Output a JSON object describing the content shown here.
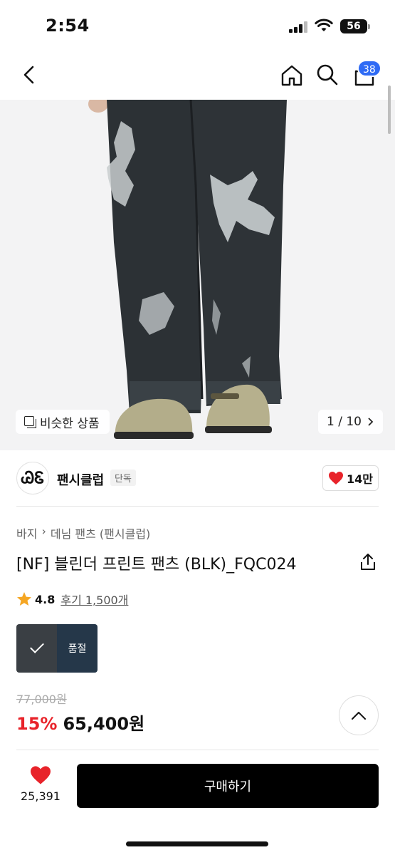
{
  "status_bar": {
    "time": "2:54",
    "battery": "56"
  },
  "nav": {
    "cart_count": "38",
    "icons": [
      "back-icon",
      "home-icon",
      "search-icon",
      "cart-icon"
    ]
  },
  "gallery": {
    "similar_label": "비슷한 상품",
    "pager": "1 / 10",
    "bg_color": "#f3f3f4"
  },
  "brand": {
    "logo_text": "ᏊᏋ",
    "name": "팬시클럽",
    "tag": "단독",
    "likes": "14만"
  },
  "breadcrumb": [
    "바지",
    "데님 팬츠 (팬시클럽)"
  ],
  "product": {
    "title": "[NF] 블린더 프린트 팬츠 (BLK)_FQC024",
    "rating": "4.8",
    "reviews": "후기 1,500개",
    "variants": [
      {
        "label": ""
      },
      {
        "label": "품절"
      }
    ],
    "original_price": "77,000원",
    "discount": "15%",
    "price": "65,400원"
  },
  "bottom": {
    "like_count": "25,391",
    "buy_label": "구매하기"
  },
  "colors": {
    "accent": "#2f6bf5",
    "discount": "#e8232a",
    "heart": "#e8232a",
    "buy_bg": "#000000"
  }
}
